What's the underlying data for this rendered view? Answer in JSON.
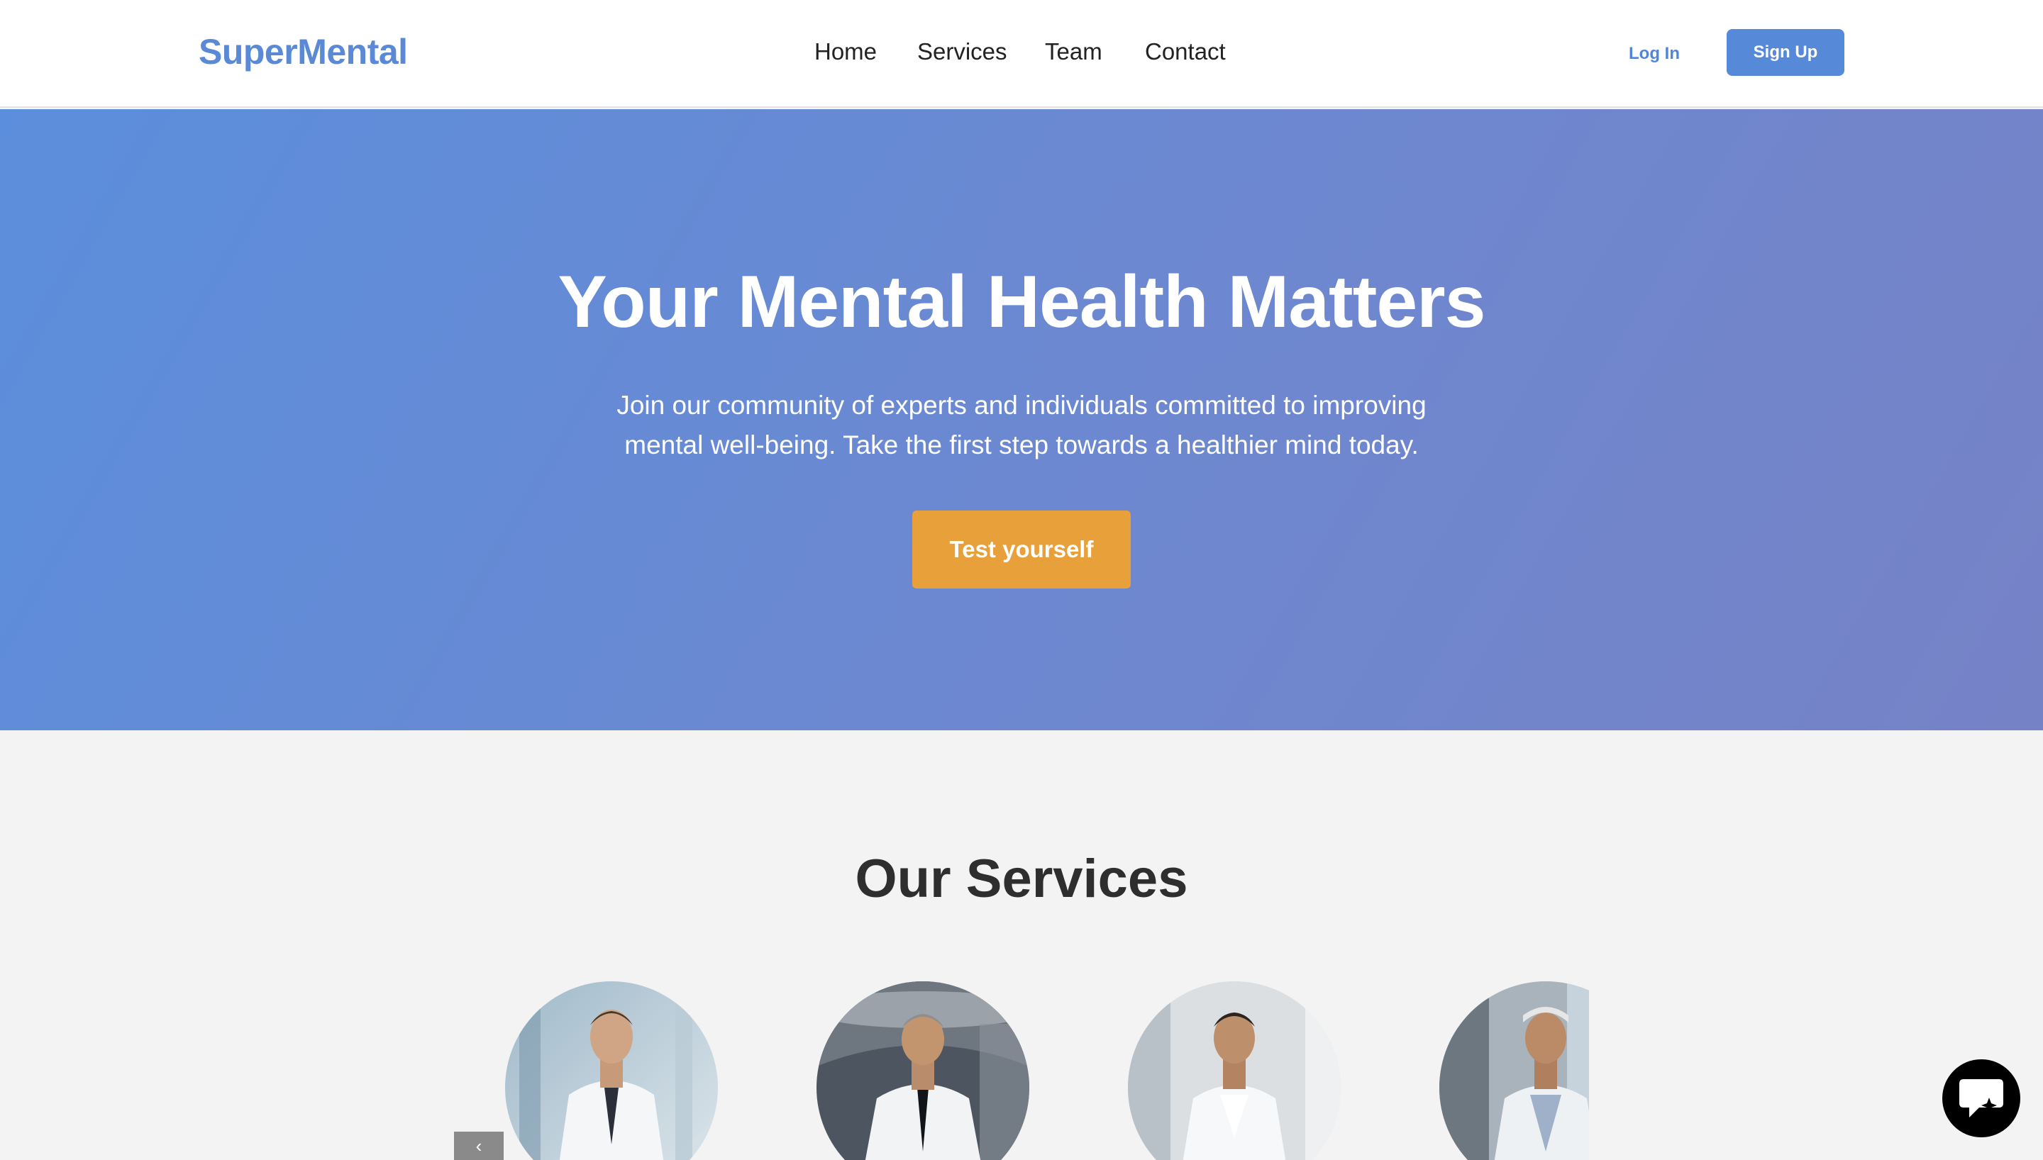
{
  "header": {
    "logo": "SuperMental",
    "nav": [
      "Home",
      "Services",
      "Team",
      "Contact"
    ],
    "login_label": "Log In",
    "signup_label": "Sign Up"
  },
  "hero": {
    "title": "Your Mental Health Matters",
    "subtitle_line1": "Join our community of experts and individuals committed to improving",
    "subtitle_line2": "mental well-being. Take the first step towards a healthier mind today.",
    "cta_label": "Test yourself"
  },
  "services": {
    "title": "Our Services",
    "avatars": [
      "doctor-portrait-1",
      "doctor-portrait-2",
      "doctor-portrait-3",
      "doctor-portrait-4"
    ]
  },
  "icons": {
    "chat": "chat-bubble-icon",
    "prev": "prev-arrow"
  },
  "colors": {
    "brand": "#5a8ad6",
    "cta": "#e8a03a",
    "hero_start": "#5b8edc",
    "hero_end": "#7682c6"
  }
}
